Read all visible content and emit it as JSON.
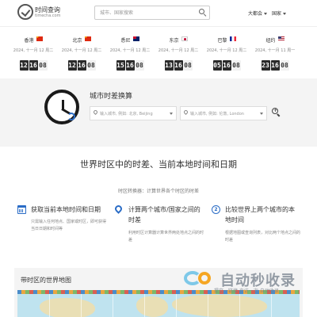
{
  "header": {
    "logo_cn": "时间查询",
    "logo_en": "timecha.com",
    "search_placeholder": "城市、国家搜索",
    "nav": [
      {
        "label": "大都会"
      },
      {
        "label": "国家"
      }
    ]
  },
  "clocks": [
    {
      "city": "香港",
      "flag": "cn",
      "date": "2024, 十一月 12 周二",
      "hh": "12",
      "mm": "16",
      "ss": "08"
    },
    {
      "city": "北京",
      "flag": "cn",
      "date": "2024, 十一月 12 周二",
      "hh": "12",
      "mm": "16",
      "ss": "08"
    },
    {
      "city": "悉尼",
      "flag": "au",
      "date": "2024, 十一月 12 周二",
      "hh": "15",
      "mm": "16",
      "ss": "08"
    },
    {
      "city": "东京",
      "flag": "jp",
      "date": "2024, 十一月 12 周二",
      "hh": "13",
      "mm": "16",
      "ss": "08"
    },
    {
      "city": "巴黎",
      "flag": "fr",
      "date": "2024, 十一月 12 周二",
      "hh": "05",
      "mm": "16",
      "ss": "08"
    },
    {
      "city": "纽约",
      "flag": "us",
      "date": "2024, 十一月 11 周一",
      "hh": "23",
      "mm": "16",
      "ss": "08"
    }
  ],
  "converter": {
    "title": "城市时差换算",
    "from_placeholder": "输入城市, 例如: 北京, Beijing",
    "to_placeholder": "输入城市, 例如: 伦敦, London"
  },
  "main": {
    "heading": "世界时区中的时差、当前本地时间和日期",
    "subheading": "时区转换器：计算世界各个时区的时差"
  },
  "features": [
    {
      "title": "获取当前本地时间和日期",
      "desc": "只需输入任何地点、国家或时区，即可获得当日日期和时间等"
    },
    {
      "title": "计算两个城市/国家之间的时差",
      "desc": "利用时区计算器计算世界两处地点之间的时差"
    },
    {
      "title": "比较世界上两个城市的本地时间",
      "desc": "根据地图或查询列表，对比两个地点之间的时差"
    }
  ],
  "map": {
    "title": "带时区的世界地图"
  },
  "watermark": {
    "text": "自动秒收录",
    "sub": "提交一链接·来访一次·自动收录"
  }
}
